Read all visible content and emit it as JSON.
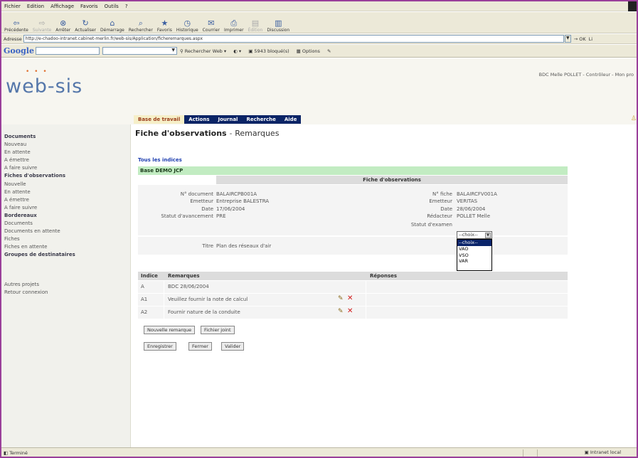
{
  "browser": {
    "menu": [
      "Fichier",
      "Edition",
      "Affichage",
      "Favoris",
      "Outils",
      "?"
    ],
    "toolbar": [
      {
        "icon": "back-arrow-icon",
        "label": "Précédente"
      },
      {
        "icon": "forward-arrow-icon",
        "label": "Suivante"
      },
      {
        "icon": "stop-icon",
        "label": "Arrêter"
      },
      {
        "icon": "refresh-icon",
        "label": "Actualiser"
      },
      {
        "icon": "home-icon",
        "label": "Démarrage"
      },
      {
        "icon": "search-icon",
        "label": "Rechercher"
      },
      {
        "icon": "favorites-icon",
        "label": "Favoris"
      },
      {
        "icon": "history-icon",
        "label": "Historique"
      },
      {
        "icon": "mail-icon",
        "label": "Courrier"
      },
      {
        "icon": "print-icon",
        "label": "Imprimer"
      },
      {
        "icon": "edit-icon",
        "label": "Édition"
      },
      {
        "icon": "discuss-icon",
        "label": "Discussion"
      }
    ],
    "address_label": "Adresse",
    "address_value": "http://e-chadoo-intranet.cabinet-merlin.fr/web-sis/Application/ficheremarques.aspx",
    "go_label": "OK",
    "links_label": "Li",
    "google": {
      "logo": "Google",
      "search_web": "Rechercher Web",
      "blocked": "5943 bloqué(s)",
      "options": "Options"
    },
    "status_text": "Terminé",
    "zone_text": "Intranet local"
  },
  "header": {
    "logo": "web-sis",
    "user_info": "BDC Melle POLLET - Contrôleur - Mon pro"
  },
  "nav": [
    "Base de travail",
    "Actions",
    "Journal",
    "Recherche",
    "Aide"
  ],
  "sidebar": [
    {
      "label": "Documents",
      "header": true
    },
    {
      "label": "Nouveau",
      "header": false
    },
    {
      "label": "En attente",
      "header": false
    },
    {
      "label": "A émettre",
      "header": false
    },
    {
      "label": "A faire suivre",
      "header": false
    },
    {
      "label": "Fiches d'observations",
      "header": true
    },
    {
      "label": "Nouvelle",
      "header": false
    },
    {
      "label": "En attente",
      "header": false
    },
    {
      "label": "A émettre",
      "header": false
    },
    {
      "label": "A faire suivre",
      "header": false
    },
    {
      "label": "Bordereaux",
      "header": true
    },
    {
      "label": "Documents",
      "header": false
    },
    {
      "label": "Documents en attente",
      "header": false
    },
    {
      "label": "Fiches",
      "header": false
    },
    {
      "label": "Fiches en attente",
      "header": false
    },
    {
      "label": "Groupes de destinataires",
      "header": true
    }
  ],
  "sidebar_links": [
    "Autres projets",
    "Retour connexion"
  ],
  "page": {
    "title": "Fiche d'observations",
    "separator": "-",
    "subtitle": "Remarques",
    "all_link": "Tous les indices",
    "base": "Base DEMO JCP",
    "fiche_header": "Fiche d'observations",
    "left_fields": [
      {
        "label": "N° document",
        "value": "BALAIRCPB001A"
      },
      {
        "label": "Emetteur",
        "value": "Entreprise BALESTRA"
      },
      {
        "label": "Date",
        "value": "17/06/2004"
      },
      {
        "label": "Statut d'avancement",
        "value": "PRE"
      }
    ],
    "right_fields": [
      {
        "label": "N° fiche",
        "value": "BALAIRCFV001A"
      },
      {
        "label": "Emetteur",
        "value": "VERITAS"
      },
      {
        "label": "Date",
        "value": "28/06/2004"
      },
      {
        "label": "Rédacteur",
        "value": "POLLET Melle"
      }
    ],
    "exam_label": "Statut d'examen",
    "exam_select": "--choix--",
    "exam_options": [
      "--choix--",
      "VAO",
      "VSO",
      "VAR"
    ],
    "titre_label": "Titre",
    "titre_value": "Plan des réseaux d'air"
  },
  "remarks": {
    "headers": [
      "Indice",
      "Remarques",
      "Réponses"
    ],
    "rows": [
      {
        "indice": "A",
        "remarque": "BDC 28/06/2004",
        "actions": false
      },
      {
        "indice": "A1",
        "remarque": "Veuillez fournir la note de calcul",
        "actions": true
      },
      {
        "indice": "A2",
        "remarque": "Fournir nature de la conduite",
        "actions": true
      }
    ]
  },
  "buttons": {
    "new_remark": "Nouvelle remarque",
    "attach": "Fichier joint",
    "save": "Enregistrer",
    "close": "Fermer",
    "validate": "Valider"
  }
}
